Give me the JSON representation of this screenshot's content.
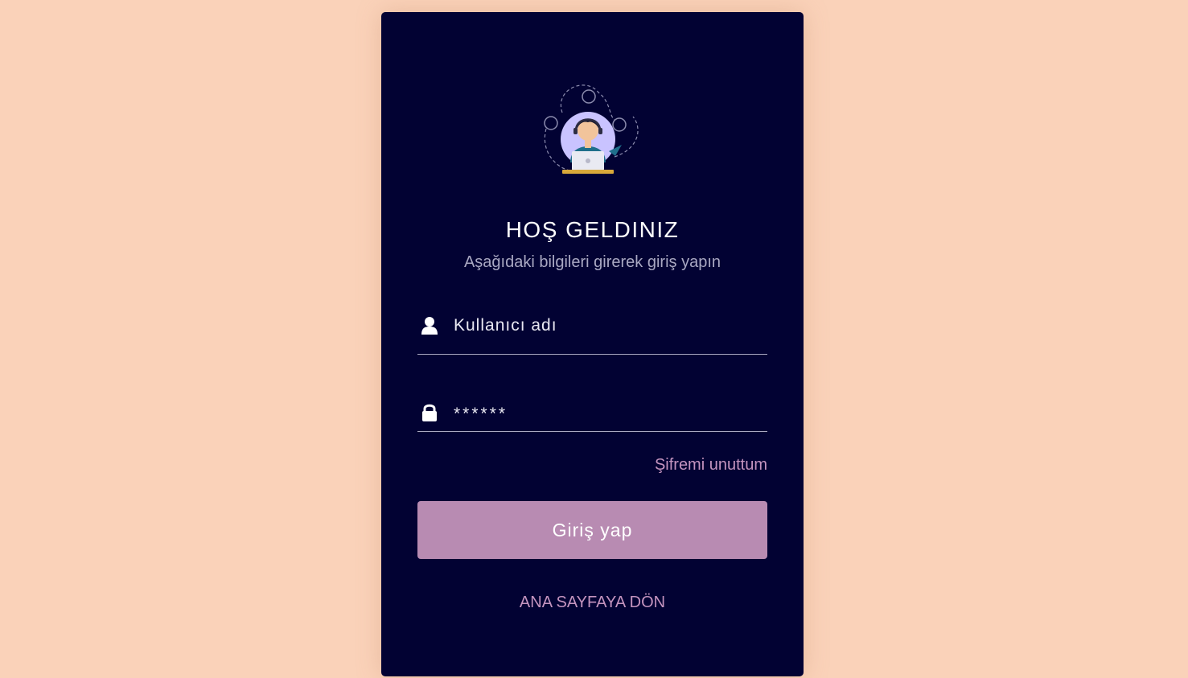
{
  "login": {
    "title": "HOŞ GELDINIZ",
    "subtitle": "Aşağıdaki bilgileri girerek giriş yapın",
    "username_placeholder": "Kullanıcı adı",
    "password_value": "******",
    "forgot_label": "Şifremi unuttum",
    "submit_label": "Giriş yap",
    "home_link_label": "ANA SAYFAYA DÖN"
  },
  "icons": {
    "username": "user-icon",
    "password": "lock-icon",
    "illustration": "support-agent-illustration"
  },
  "colors": {
    "page_background": "#fad2b9",
    "card_background": "#020233",
    "button": "#b88bb2",
    "link": "#c494bf",
    "subtitle": "#a9a8c2"
  }
}
